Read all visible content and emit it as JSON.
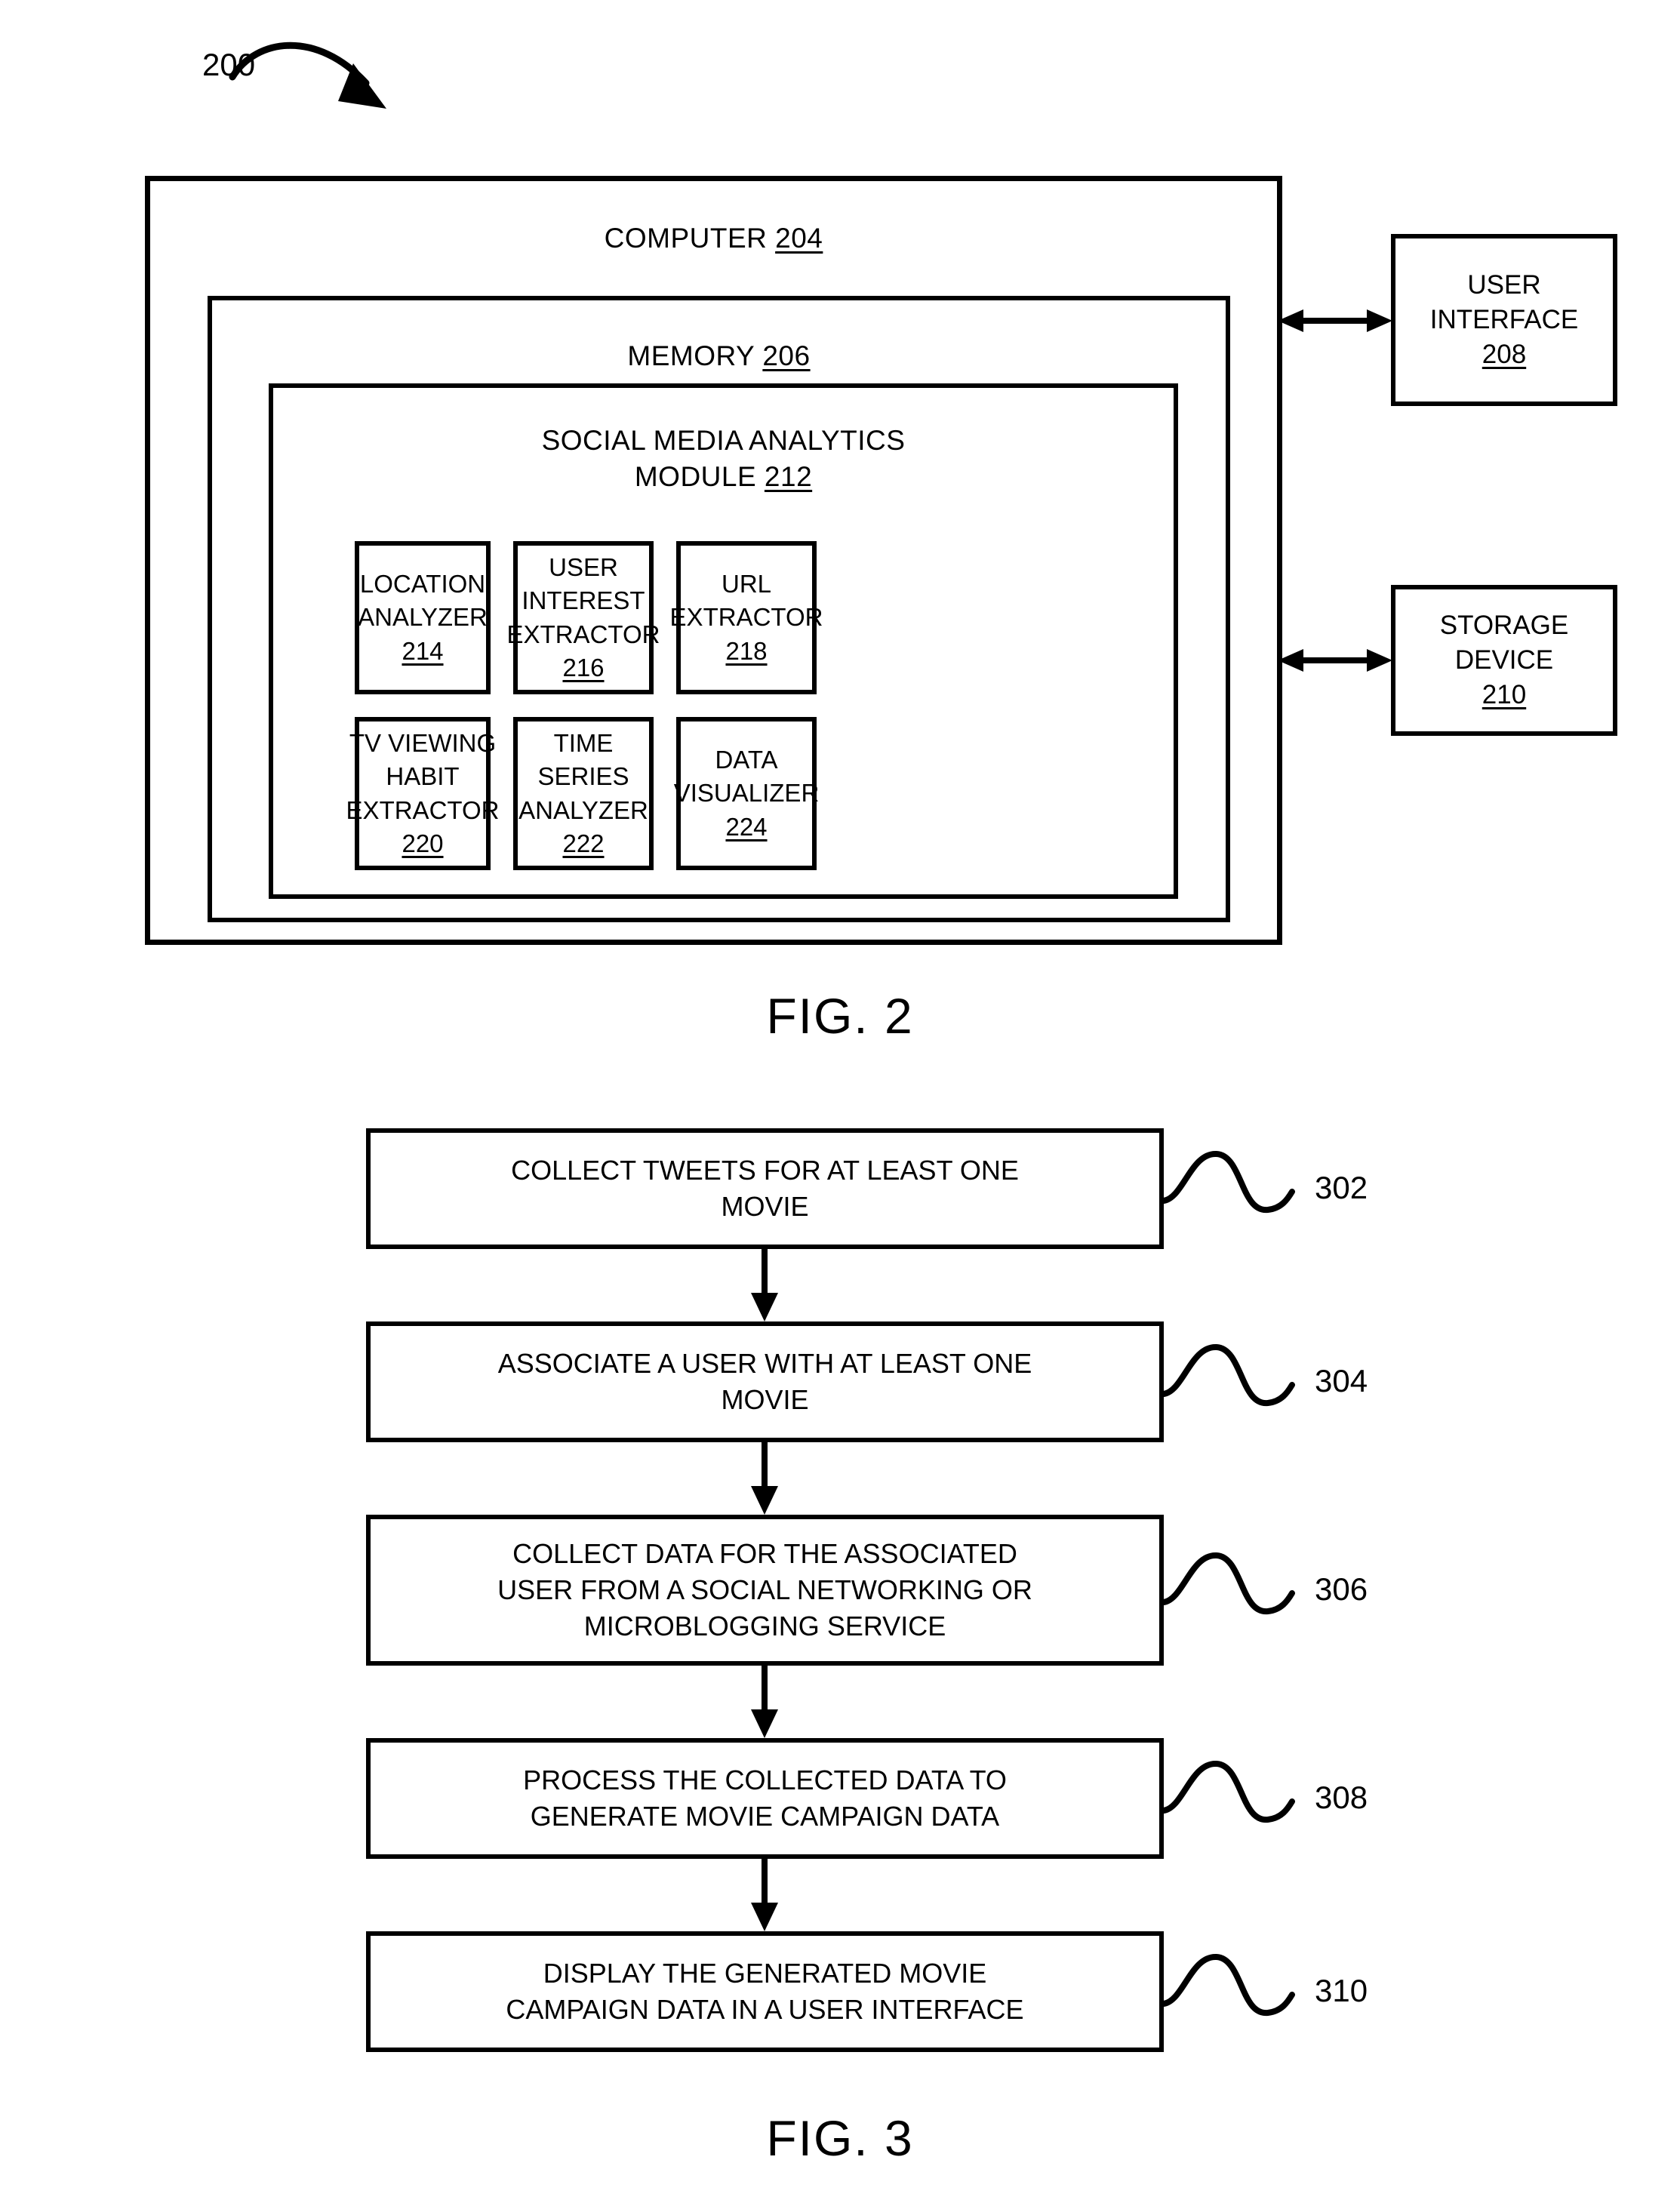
{
  "figure2": {
    "caption": "FIG. 2",
    "system_ref": "200",
    "computer": {
      "title": "COMPUTER ",
      "ref": "204"
    },
    "memory": {
      "title": "MEMORY ",
      "ref": "206"
    },
    "module": {
      "title_line1": "SOCIAL MEDIA ANALYTICS",
      "title_line2": "MODULE ",
      "ref": "212"
    },
    "components": [
      {
        "label": "LOCATION\nANALYZER\n",
        "ref": "214"
      },
      {
        "label": "USER\nINTEREST\nEXTRACTOR\n",
        "ref": "216"
      },
      {
        "label": "URL\nEXTRACTOR\n",
        "ref": "218"
      },
      {
        "label": "TV VIEWING\nHABIT\nEXTRACTOR\n",
        "ref": "220"
      },
      {
        "label": "TIME SERIES\nANALYZER\n",
        "ref": "222"
      },
      {
        "label": "DATA\nVISUALIZER\n",
        "ref": "224"
      }
    ],
    "peripherals": [
      {
        "label": "USER\nINTERFACE\n",
        "ref": "208"
      },
      {
        "label": "STORAGE\nDEVICE\n",
        "ref": "210"
      }
    ]
  },
  "figure3": {
    "caption": "FIG. 3",
    "steps": [
      {
        "text": "COLLECT TWEETS FOR AT LEAST ONE\nMOVIE",
        "ref": "302"
      },
      {
        "text": "ASSOCIATE A USER WITH AT LEAST ONE\nMOVIE",
        "ref": "304"
      },
      {
        "text": "COLLECT DATA FOR THE ASSOCIATED\nUSER FROM A SOCIAL NETWORKING OR\nMICROBLOGGING SERVICE",
        "ref": "306"
      },
      {
        "text": "PROCESS THE COLLECTED DATA TO\nGENERATE MOVIE CAMPAIGN DATA",
        "ref": "308"
      },
      {
        "text": "DISPLAY THE GENERATED MOVIE\nCAMPAIGN DATA IN A USER INTERFACE",
        "ref": "310"
      }
    ]
  },
  "colors": {
    "ink": "#000000",
    "paper": "#ffffff"
  }
}
